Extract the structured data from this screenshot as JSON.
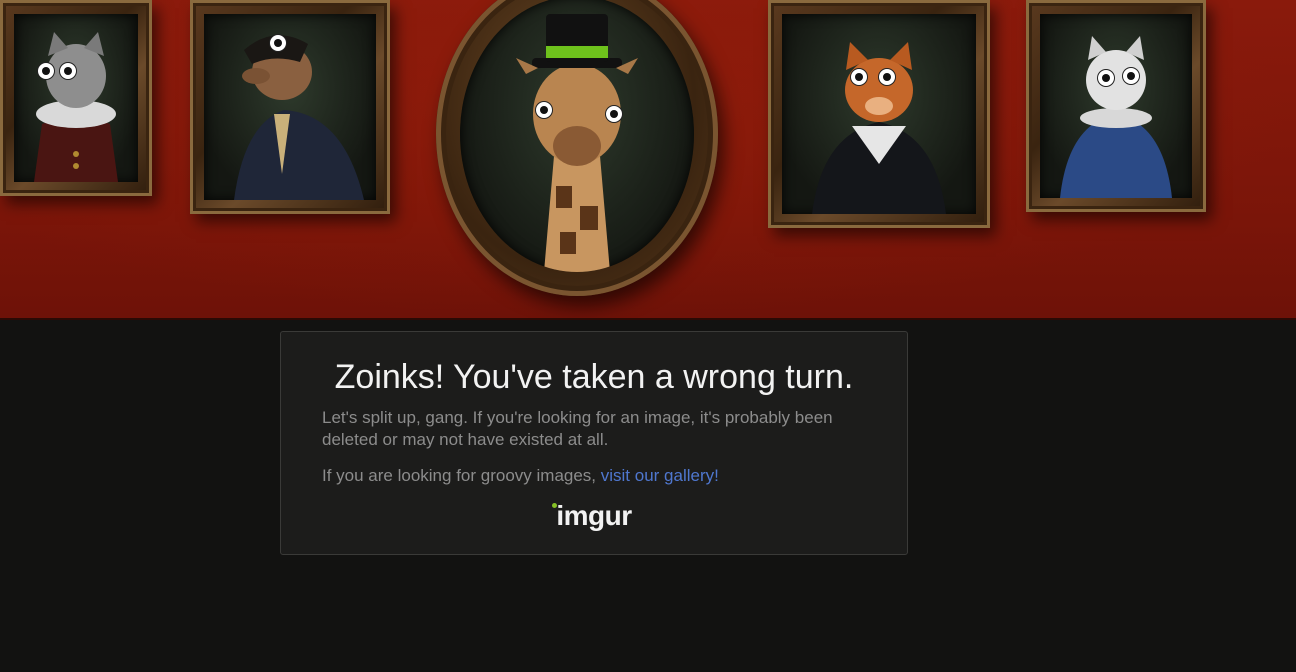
{
  "banner": {
    "portraits": [
      {
        "name": "cat-portrait-ruff"
      },
      {
        "name": "otter-portrait"
      },
      {
        "name": "giraffe-portrait-top-hat"
      },
      {
        "name": "orange-cat-portrait"
      },
      {
        "name": "white-cat-portrait"
      }
    ],
    "colors": {
      "wall": "#7a1509",
      "frame": "#5b3a1f"
    }
  },
  "error": {
    "title": "Zoinks! You've taken a wrong turn.",
    "message": "Let's split up, gang. If you're looking for an image, it's probably been deleted or may not have existed at all.",
    "gallery_prefix": "If you are looking for groovy images, ",
    "gallery_link": "visit our gallery!",
    "logo_text": "imgur"
  },
  "colors": {
    "background": "#121211",
    "card": "#1c1c1b",
    "link": "#4f77cf",
    "logo_dot": "#85bf25"
  }
}
